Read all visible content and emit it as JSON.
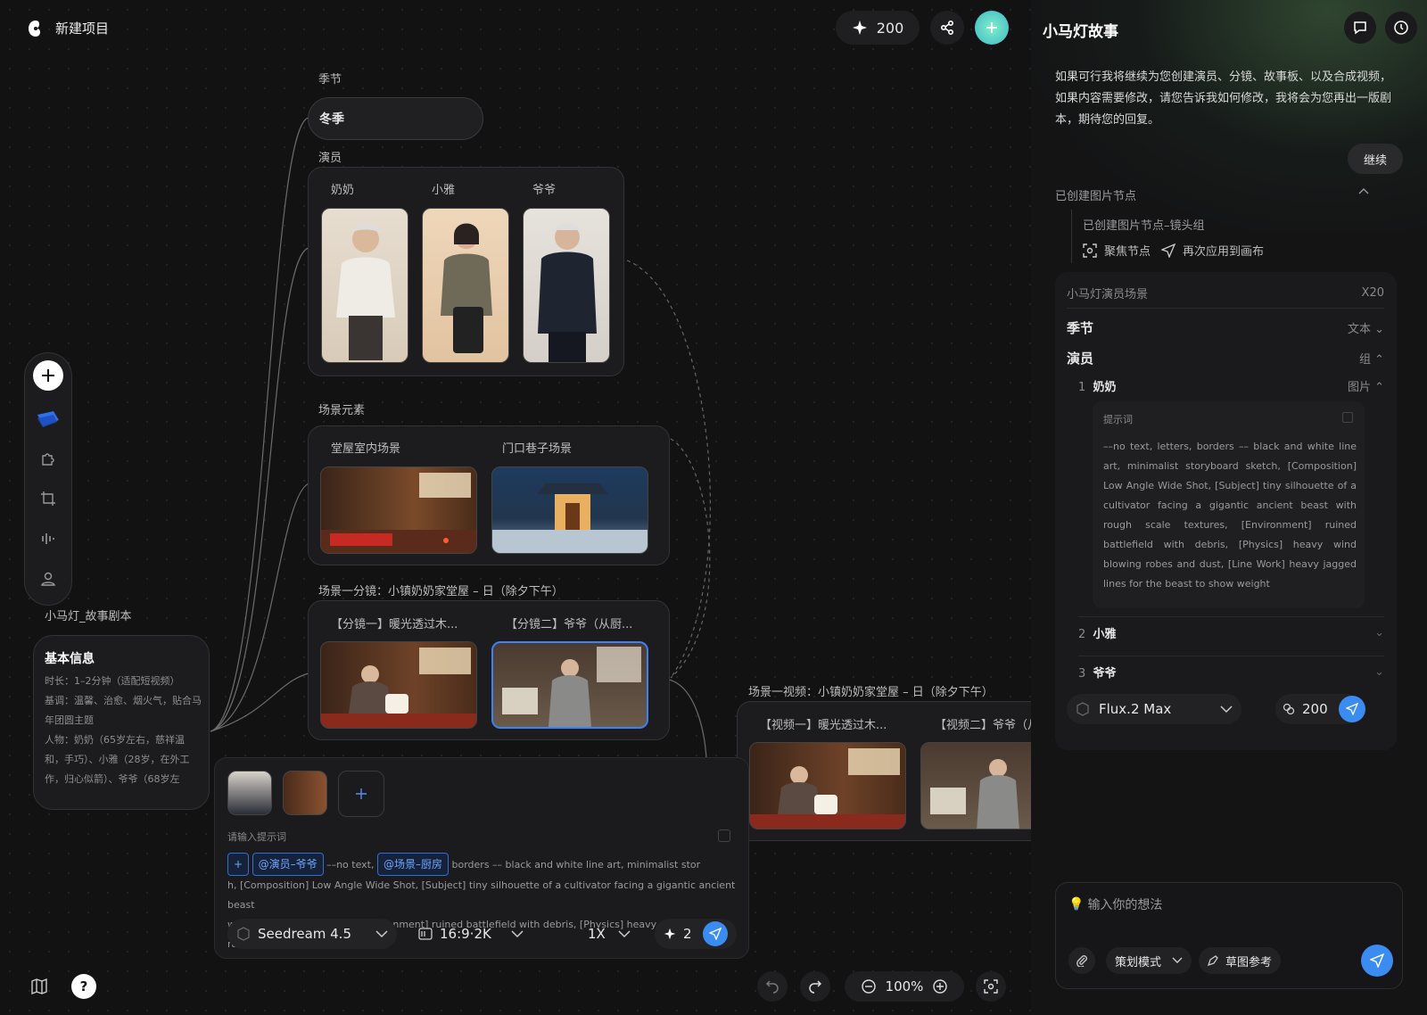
{
  "app": {
    "title": "新建项目",
    "credits": "200"
  },
  "nodes": {
    "season": {
      "label": "季节",
      "value": "冬季"
    },
    "actors": {
      "label": "演员",
      "names": [
        "奶奶",
        "小雅",
        "爷爷"
      ]
    },
    "scene_elements": {
      "label": "场景元素",
      "names": [
        "堂屋室内场景",
        "门口巷子场景"
      ]
    },
    "shots": {
      "label": "场景一分镜：小镇奶奶家堂屋 – 日（除夕下午）",
      "names": [
        "【分镜一】暖光透过木...",
        "【分镜二】爷爷（从厨..."
      ]
    },
    "video": {
      "label": "场景一视频：小镇奶奶家堂屋 – 日（除夕下午）",
      "names": [
        "【视频一】暖光透过木...",
        "【视频二】爷爷（从"
      ]
    },
    "script": {
      "label": "小马灯_故事剧本",
      "title": "基本信息",
      "lines": [
        "时长：1–2分钟（适配短视频）",
        "基调：温馨、治愈、烟火气，贴合马年团圆主题",
        "人物：奶奶（65岁左右，慈祥温和，手巧）、小雅（28岁，在外工作，归心似箭）、爷爷（68岁左"
      ]
    }
  },
  "editor": {
    "placeholder_label": "请输入提示词",
    "tag_actor": "@演员–爷爷",
    "tag_scene": "@场景–厨房",
    "text_a": "––no text,",
    "text_b": "borders –– black and white line art, minimalist stor",
    "text_c": "h, [Composition] Low Angle Wide Shot, [Subject] tiny silhouette of a cultivator facing a gigantic ancient beast",
    "text_d": "with rough scale textures, [Environment] ruined battlefield with debris, [Physics] heavy wind blowing robes",
    "model": "Seedream 4.5",
    "ratio": "16:9·2K",
    "multiplier": "1X",
    "cost": "2"
  },
  "toolbar": {
    "zoom": "100%"
  },
  "panel": {
    "title": "小马灯故事",
    "message": "如果可行我将继续为您创建演员、分镜、故事板、以及合成视频，如果内容需要修改，请您告诉我如何修改，我将会为您再出一版剧本，期待您的回复。",
    "continue": "继续",
    "created_header": "已创建图片节点",
    "created_item": "已创建图片节点–镜头组",
    "focus": "聚焦节点",
    "reapply": "再次应用到画布",
    "card_title": "小马灯演员场景",
    "card_count": "X20",
    "rows": [
      {
        "label": "季节",
        "type": "文本"
      },
      {
        "label": "演员",
        "type": "组"
      }
    ],
    "sub1": {
      "num": "1",
      "name": "奶奶",
      "type": "图片"
    },
    "prompt_label": "提示词",
    "prompt": "––no text, letters, borders –– black and white line art, minimalist storyboard sketch, [Composition] Low Angle Wide Shot, [Subject] tiny silhouette of a cultivator facing a gigantic ancient beast with rough scale textures, [Environment] ruined battlefield with debris, [Physics] heavy wind blowing robes and dust, [Line Work] heavy jagged lines for the beast to show weight",
    "sub2": {
      "num": "2",
      "name": "小雅"
    },
    "sub3": {
      "num": "3",
      "name": "爷爷"
    },
    "model": "Flux.2 Max",
    "cost": "200",
    "input_placeholder": "输入你的想法",
    "mode": "策划模式",
    "sketch": "草图参考"
  }
}
